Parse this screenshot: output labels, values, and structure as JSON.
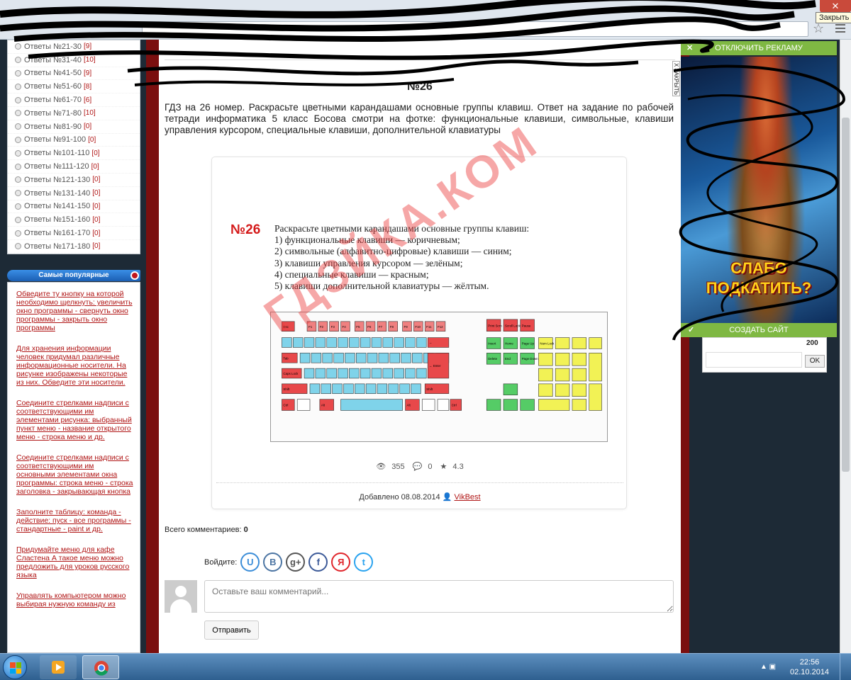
{
  "browser": {
    "close_tooltip": "Закрыть",
    "close_glyph": "✕",
    "star_glyph": "☆"
  },
  "sidebar": {
    "items": [
      {
        "label": "Ответы №21-30",
        "count": "[9]"
      },
      {
        "label": "Ответы №31-40",
        "count": "[10]"
      },
      {
        "label": "Ответы №41-50",
        "count": "[9]"
      },
      {
        "label": "Ответы №51-60",
        "count": "[8]"
      },
      {
        "label": "Ответы №61-70",
        "count": "[6]"
      },
      {
        "label": "Ответы №71-80",
        "count": "[10]"
      },
      {
        "label": "Ответы №81-90",
        "count": "[0]"
      },
      {
        "label": "Ответы №91-100",
        "count": "[0]"
      },
      {
        "label": "Ответы №101-110",
        "count": "[0]"
      },
      {
        "label": "Ответы №111-120",
        "count": "[0]"
      },
      {
        "label": "Ответы №121-130",
        "count": "[0]"
      },
      {
        "label": "Ответы №131-140",
        "count": "[0]"
      },
      {
        "label": "Ответы №141-150",
        "count": "[0]"
      },
      {
        "label": "Ответы №151-160",
        "count": "[0]"
      },
      {
        "label": "Ответы №161-170",
        "count": "[0]"
      },
      {
        "label": "Ответы №171-180",
        "count": "[0]"
      }
    ],
    "popular_title": "Самые популярные",
    "popular": [
      "Обведите ту кнопку на которой необходимо щелкнуть: увеличить окно программы - свернуть окно программы - закрыть окно программы",
      "Для хранения информации человек придумал различные информационные носители. На рисунке изображены некоторые из них. Обведите эти носители.",
      "Соедините стрелками надписи с соответствующими им элементами рисунка: выбранный пункт меню - название открытого меню - строка меню и др.",
      "Соедините стрелками надписи с соответствующими им основными элементами окна программы: строка меню - строка заголовка - закрывающая кнопка",
      "Заполните таблицу: команда - действие: пуск - все программы - стандартные - paint и др.",
      "Придумайте меню для кафе Сластена А такое меню можно предложить для уроков русского языка",
      "Управлять компьютером можно выбирая нужную команду из"
    ]
  },
  "main": {
    "heading": "№26",
    "description": "ГДЗ на 26 номер. Раскрасьте цветными карандашами основные группы клавиш. Ответ на задание по рабочей тетради информатика 5 класс Босова смотри на фотке: функциональные клавиши, символьные, клавиши управления курсором, специальные клавиши, дополнительной клавиатуры",
    "task": {
      "number": "№26",
      "lines": [
        "Раскрасьте цветными карандашами основные группы клавиш:",
        "1) функциональные клавиши — коричневым;",
        "2) символьные (алфавитно-цифровые) клавиши — синим;",
        "3) клавиши управления курсором — зелёным;",
        "4) специальные клавиши — красным;",
        "5) клавиши дополнительной клавиатуры — жёлтым."
      ],
      "watermark": "ГДЗЙКА.КОМ"
    },
    "keyboard": {
      "function_color": "#f08080",
      "symbol_color": "#7fd3ea",
      "cursor_color": "#55cc66",
      "special_color": "#e8484a",
      "numpad_color": "#f2f255",
      "key_labels": {
        "esc": "Esc",
        "tab": "Tab",
        "caps": "Caps Lock",
        "shift": "Shift",
        "ctrl": "Ctrl",
        "alt": "Alt",
        "enter": "← Enter",
        "backspace": "←",
        "print": "Print Scrn",
        "scroll": "Scroll Lock",
        "pause": "Pause",
        "insert": "Insert",
        "home": "Home",
        "pgup": "Page Up",
        "delete": "Delete",
        "end": "End",
        "pgdn": "Page Down",
        "num": "Num Lock",
        "f_prefix": "F"
      }
    },
    "stats": {
      "views": "355",
      "comments": "0",
      "rating": "4.3"
    },
    "added_label": "Добавлено 08.08.2014",
    "author": "VikBest",
    "comments_total_label": "Всего комментариев:",
    "comments_total_value": "0",
    "login_label": "Войдите:",
    "social": [
      {
        "name": "u",
        "glyph": "U",
        "color": "#3b8dd8"
      },
      {
        "name": "vk",
        "glyph": "B",
        "color": "#4c75a3"
      },
      {
        "name": "google-plus",
        "glyph": "g+",
        "color": "#555555"
      },
      {
        "name": "facebook",
        "glyph": "f",
        "color": "#3b5998"
      },
      {
        "name": "yandex",
        "glyph": "Я",
        "color": "#e0252b"
      },
      {
        "name": "twitter",
        "glyph": "t",
        "color": "#2aa3ef"
      }
    ],
    "comment_placeholder": "Оставьте ваш комментарий...",
    "send_label": "Отправить"
  },
  "ad": {
    "disable_label": "ОТКЛЮЧИТЬ РЕКЛАМУ",
    "banner_text_1": "СЛАБО",
    "banner_text_2": "ПОДКАТИТЬ?",
    "side_label": "Х ЗАКРЫТЬ",
    "bottom_label": "СОЗДАТЬ САЙТ",
    "counter": "200",
    "ok_label": "OK"
  },
  "taskbar": {
    "time": "22:56",
    "date": "02.10.2014"
  }
}
